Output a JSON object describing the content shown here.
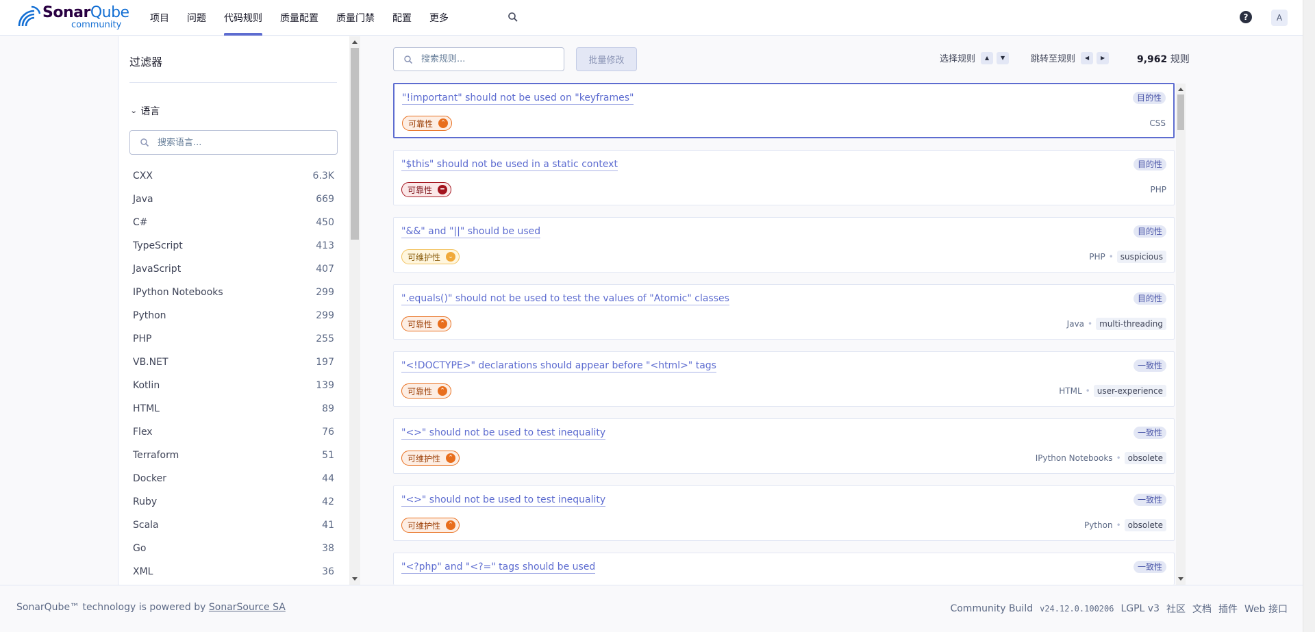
{
  "app": {
    "logo_main": "Sonar",
    "logo_bold": "Qube",
    "logo_sub": "community"
  },
  "nav": {
    "items": [
      {
        "label": "项目"
      },
      {
        "label": "问题"
      },
      {
        "label": "代码规则",
        "active": true
      },
      {
        "label": "质量配置"
      },
      {
        "label": "质量门禁"
      },
      {
        "label": "配置"
      },
      {
        "label": "更多"
      }
    ],
    "help_label": "?",
    "avatar_letter": "A"
  },
  "sidebar": {
    "title": "过滤器",
    "language_section": "语言",
    "language_search_placeholder": "搜索语言...",
    "languages": [
      {
        "name": "CXX",
        "count": "6.3K"
      },
      {
        "name": "Java",
        "count": "669"
      },
      {
        "name": "C#",
        "count": "450"
      },
      {
        "name": "TypeScript",
        "count": "413"
      },
      {
        "name": "JavaScript",
        "count": "407"
      },
      {
        "name": "IPython Notebooks",
        "count": "299"
      },
      {
        "name": "Python",
        "count": "299"
      },
      {
        "name": "PHP",
        "count": "255"
      },
      {
        "name": "VB.NET",
        "count": "197"
      },
      {
        "name": "Kotlin",
        "count": "139"
      },
      {
        "name": "HTML",
        "count": "89"
      },
      {
        "name": "Flex",
        "count": "76"
      },
      {
        "name": "Terraform",
        "count": "51"
      },
      {
        "name": "Docker",
        "count": "44"
      },
      {
        "name": "Ruby",
        "count": "42"
      },
      {
        "name": "Scala",
        "count": "41"
      },
      {
        "name": "Go",
        "count": "38"
      },
      {
        "name": "XML",
        "count": "36"
      }
    ]
  },
  "toolbar": {
    "search_placeholder": "搜索规则...",
    "bulk_change": "批量修改",
    "select_rules": "选择规则",
    "jump_to_rule": "跳转至规则",
    "total_count": "9,962",
    "total_unit": "规则"
  },
  "rules": [
    {
      "title": "\"!important\" should not be used on \"keyframes\"",
      "type": "目的性",
      "impact": "可靠性",
      "severity": "high",
      "language": "CSS",
      "tag": ""
    },
    {
      "title": "\"$this\" should not be used in a static context",
      "type": "目的性",
      "impact": "可靠性",
      "severity": "blocker",
      "language": "PHP",
      "tag": ""
    },
    {
      "title": "\"&&\" and \"||\" should be used",
      "type": "目的性",
      "impact": "可维护性",
      "severity": "medium",
      "language": "PHP",
      "tag": "suspicious"
    },
    {
      "title": "\".equals()\" should not be used to test the values of \"Atomic\" classes",
      "type": "目的性",
      "impact": "可靠性",
      "severity": "high",
      "language": "Java",
      "tag": "multi-threading"
    },
    {
      "title": "\"<!DOCTYPE>\" declarations should appear before \"<html>\" tags",
      "type": "一致性",
      "impact": "可靠性",
      "severity": "high",
      "language": "HTML",
      "tag": "user-experience"
    },
    {
      "title": "\"<>\" should not be used to test inequality",
      "type": "一致性",
      "impact": "可维护性",
      "severity": "high",
      "language": "IPython Notebooks",
      "tag": "obsolete"
    },
    {
      "title": "\"<>\" should not be used to test inequality",
      "type": "一致性",
      "impact": "可维护性",
      "severity": "high",
      "language": "Python",
      "tag": "obsolete"
    },
    {
      "title": "\"<?php\" and \"<?=\" tags should be used",
      "type": "一致性",
      "impact": "",
      "severity": "",
      "language": "",
      "tag": ""
    }
  ],
  "footer": {
    "powered_prefix": "SonarQube™ technology is powered by ",
    "powered_link": "SonarSource SA",
    "build": "Community Build",
    "version": "v24.12.0.100206",
    "license": "LGPL v3",
    "community": "社区",
    "docs": "文档",
    "plugins": "插件",
    "web_api": "Web 接口"
  },
  "colors": {
    "accent": "#5d6cd0",
    "impact_high": "#e86e1d",
    "impact_blocker": "#a3141e",
    "impact_medium": "#f0a93a"
  }
}
